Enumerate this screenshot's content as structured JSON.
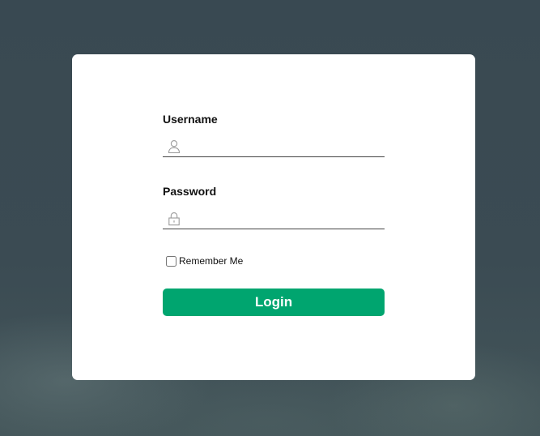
{
  "login_form": {
    "username": {
      "label": "Username",
      "value": "",
      "icon": "user-icon"
    },
    "password": {
      "label": "Password",
      "value": "",
      "icon": "lock-icon"
    },
    "remember_me": {
      "label": "Remember Me",
      "checked": false
    },
    "submit_label": "Login"
  },
  "colors": {
    "background": "#3a4a52",
    "card": "#ffffff",
    "button": "#00a56f",
    "button_text": "#ffffff",
    "underline": "#444444",
    "icon": "#9a9a9a"
  }
}
